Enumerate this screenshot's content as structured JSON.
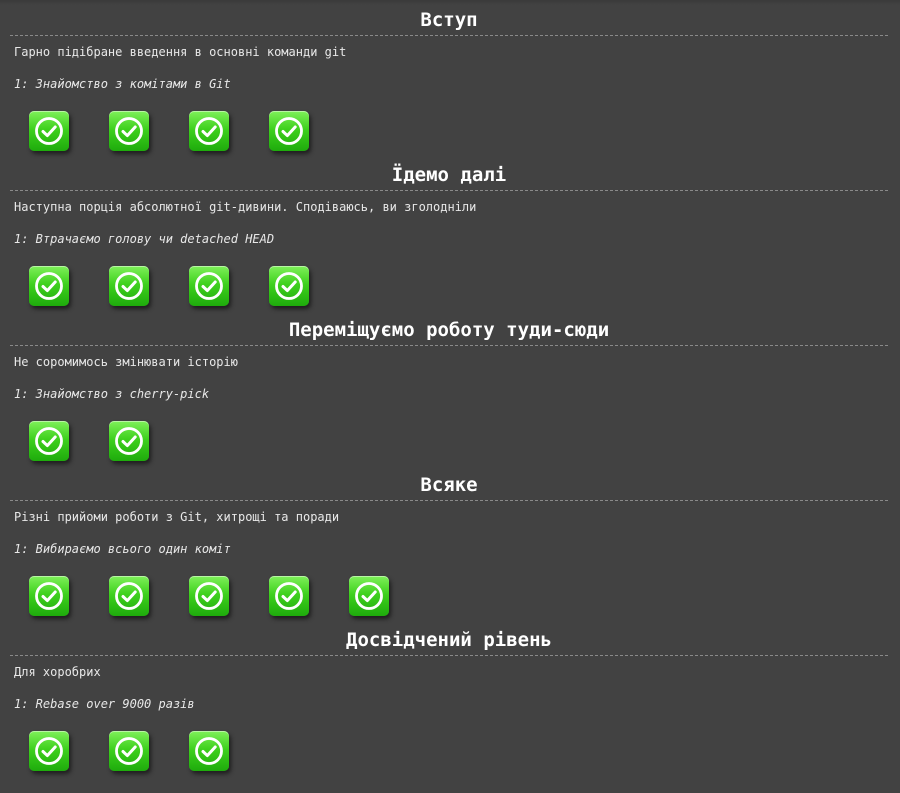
{
  "sequences": [
    {
      "title": "Вступ",
      "about": "Гарно підібране введення в основні команди git",
      "level_label": "1: Знайомство з комітами в Git",
      "levels": [
        {
          "status": "solved",
          "icon": "check-icon"
        },
        {
          "status": "solved",
          "icon": "check-icon"
        },
        {
          "status": "solved",
          "icon": "check-icon"
        },
        {
          "status": "solved",
          "icon": "check-icon"
        }
      ]
    },
    {
      "title": "Їдемо далі",
      "about": "Наступна порція абсолютної git-дивини. Сподіваюсь, ви зголодніли",
      "level_label": "1: Втрачаємо голову чи detached HEAD",
      "levels": [
        {
          "status": "solved",
          "icon": "check-icon"
        },
        {
          "status": "solved",
          "icon": "check-icon"
        },
        {
          "status": "solved",
          "icon": "check-icon"
        },
        {
          "status": "solved",
          "icon": "check-icon"
        }
      ]
    },
    {
      "title": "Переміщуємо роботу туди-сюди",
      "about": "Не соромимось змінювати історію",
      "level_label": "1: Знайомство з cherry-pick",
      "levels": [
        {
          "status": "solved",
          "icon": "check-icon"
        },
        {
          "status": "solved",
          "icon": "check-icon"
        }
      ]
    },
    {
      "title": "Всяке",
      "about": "Різні прийоми роботи з Git, хитрощі та поради",
      "level_label": "1: Вибираємо всього один коміт",
      "levels": [
        {
          "status": "solved",
          "icon": "check-icon"
        },
        {
          "status": "solved",
          "icon": "check-icon"
        },
        {
          "status": "solved",
          "icon": "check-icon"
        },
        {
          "status": "solved",
          "icon": "check-icon"
        },
        {
          "status": "solved",
          "icon": "check-icon"
        }
      ]
    },
    {
      "title": "Досвідчений рівень",
      "about": "Для хоробрих",
      "level_label": "1: Rebase over 9000 разів",
      "levels": [
        {
          "status": "solved",
          "icon": "check-icon"
        },
        {
          "status": "solved",
          "icon": "check-icon"
        },
        {
          "status": "solved",
          "icon": "check-icon"
        }
      ]
    }
  ],
  "colors": {
    "background": "#424242",
    "solved_green": "#3fd11e",
    "text": "#e8e8e8"
  }
}
